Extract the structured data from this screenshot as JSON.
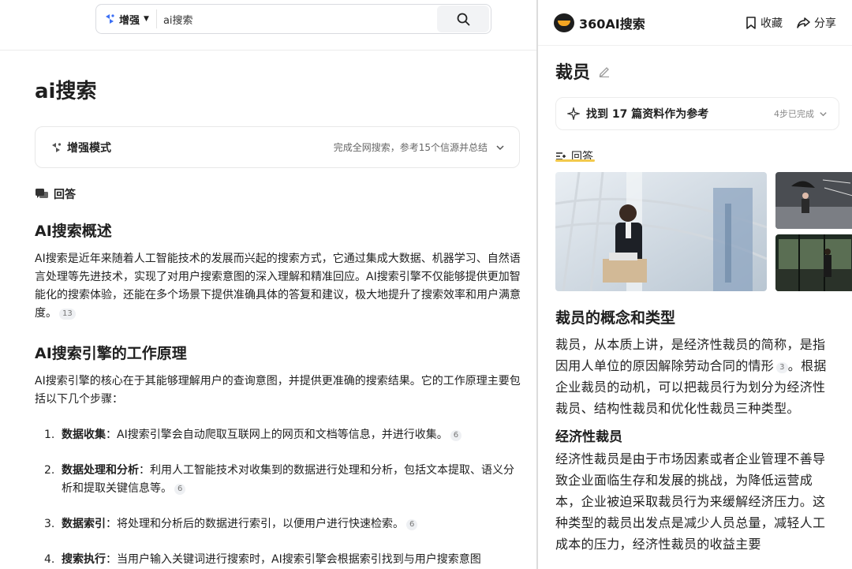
{
  "left": {
    "search": {
      "mode_label": "增强",
      "query": "ai搜索"
    },
    "page_title": "ai搜索",
    "enhance": {
      "label": "增强模式",
      "meta": "完成全网搜索，参考15个信源并总结"
    },
    "answer_label": "回答",
    "section1": {
      "heading": "AI搜索概述",
      "text": "AI搜索是近年来随着人工智能技术的发展而兴起的搜索方式，它通过集成大数据、机器学习、自然语言处理等先进技术，实现了对用户搜索意图的深入理解和精准回应。AI搜索引擎不仅能够提供更加智能化的搜索体验，还能在多个场景下提供准确具体的答复和建议，极大地提升了搜索效率和用户满意度。",
      "cite": "13"
    },
    "section2": {
      "heading": "AI搜索引擎的工作原理",
      "text": "AI搜索引擎的核心在于其能够理解用户的查询意图，并提供更准确的搜索结果。它的工作原理主要包括以下几个步骤："
    },
    "steps": [
      {
        "num": "1.",
        "title": "数据收集",
        "text": "：AI搜索引擎会自动爬取互联网上的网页和文档等信息，并进行收集。",
        "cite": "6"
      },
      {
        "num": "2.",
        "title": "数据处理和分析",
        "text": "：利用人工智能技术对收集到的数据进行处理和分析，包括文本提取、语义分析和提取关键信息等。",
        "cite": "6"
      },
      {
        "num": "3.",
        "title": "数据索引",
        "text": "：将处理和分析后的数据进行索引，以便用户进行快速检索。",
        "cite": "6"
      },
      {
        "num": "4.",
        "title": "搜索执行",
        "text": "：当用户输入关键词进行搜索时，AI搜索引擎会根据索引找到与用户搜索意图",
        "cite": ""
      }
    ]
  },
  "right": {
    "brand": "360AI搜索",
    "actions": {
      "collect": "收藏",
      "share": "分享"
    },
    "title": "裁员",
    "refs": {
      "label": "找到 17 篇资料作为参考",
      "meta": "4步已完成"
    },
    "answer_label": "回答",
    "h_concept": "裁员的概念和类型",
    "p_concept_a": "裁员，从本质上讲，是经济性裁员的简称，是指因用人单位的原因解除劳动合同的情形",
    "p_concept_cite": "3",
    "p_concept_b": "。根据企业裁员的动机，可以把裁员行为划分为经济性裁员、结构性裁员和优化性裁员三种类型。",
    "h_econ": "经济性裁员",
    "p_econ": "经济性裁员是由于市场因素或者企业管理不善导致企业面临生存和发展的挑战，为降低运营成本，企业被迫采取裁员行为来缓解经济压力。这种类型的裁员出发点是减少人员总量，减轻人工成本的压力，经济性裁员的收益主要"
  },
  "colors": {
    "accent_yellow": "#f2c94c",
    "logo_orange": "#f5a623",
    "text": "#1f1f1f"
  }
}
